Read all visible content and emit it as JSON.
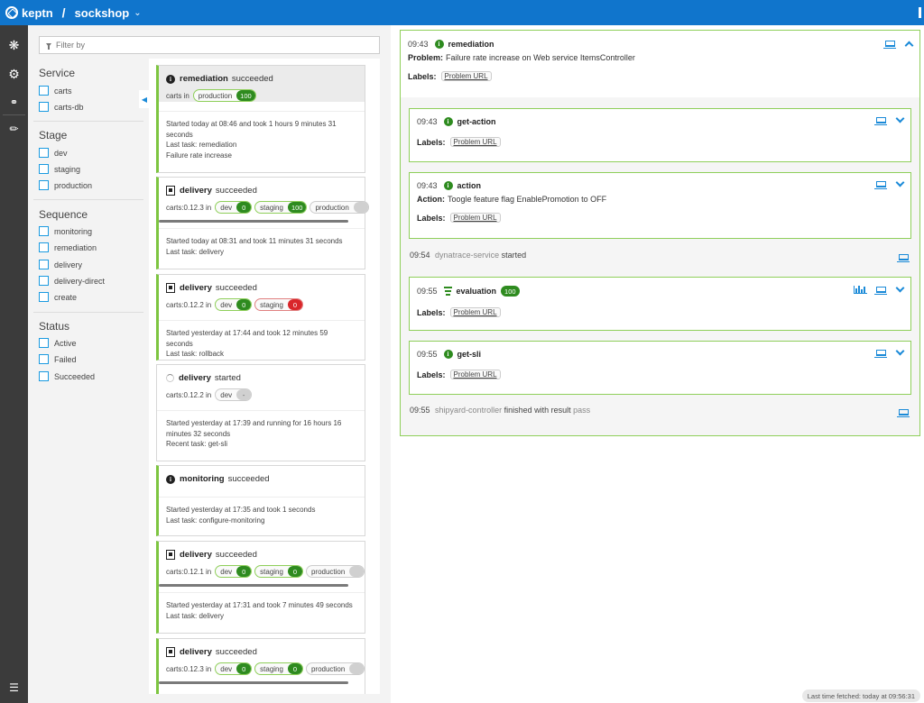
{
  "header": {
    "brand": "keptn",
    "separator": "/",
    "project": "sockshop",
    "project_chevron": "chevron-down-icon"
  },
  "nav": {
    "icons": [
      "services-icon",
      "settings-icon",
      "integrations-icon",
      "sequences-icon",
      "menu-icon"
    ]
  },
  "filter": {
    "placeholder": "Filter by",
    "groups": {
      "service": {
        "title": "Service",
        "options": [
          "carts",
          "carts-db"
        ]
      },
      "stage": {
        "title": "Stage",
        "options": [
          "dev",
          "staging",
          "production"
        ]
      },
      "sequence": {
        "title": "Sequence",
        "options": [
          "monitoring",
          "remediation",
          "delivery",
          "delivery-direct",
          "create"
        ]
      },
      "status": {
        "title": "Status",
        "options": [
          "Active",
          "Failed",
          "Succeeded"
        ]
      }
    }
  },
  "sequences": [
    {
      "name": "remediation",
      "status": "succeeded",
      "lead": "carts in",
      "stages": [
        {
          "name": "production",
          "badge": "100"
        }
      ],
      "desc": [
        "Started today at 08:46 and took 1 hours 9 minutes 31",
        "seconds",
        "Last task: remediation",
        "Failure rate increase"
      ]
    },
    {
      "name": "delivery",
      "status": "succeeded",
      "lead": "carts:0.12.3 in",
      "stages": [
        {
          "name": "dev",
          "badge": "0"
        },
        {
          "name": "staging",
          "badge": "100"
        },
        {
          "name": "production",
          "badge": ""
        }
      ],
      "desc": [
        "Started today at 08:31 and took 11 minutes 31 seconds",
        "Last task: delivery"
      ]
    },
    {
      "name": "delivery",
      "status": "succeeded",
      "lead": "carts:0.12.2 in",
      "stages": [
        {
          "name": "dev",
          "badge": "0"
        },
        {
          "name": "staging",
          "badge": "0"
        }
      ],
      "desc": [
        "Started yesterday at 17:44 and took 12 minutes 59 seconds",
        "Last task: rollback"
      ]
    },
    {
      "name": "delivery",
      "status": "started",
      "lead": "carts:0.12.2 in",
      "stages": [
        {
          "name": "dev",
          "badge": "-"
        }
      ],
      "desc": [
        "Started yesterday at 17:39 and running for 16 hours 16",
        "minutes 32 seconds",
        "Recent task: get-sli"
      ]
    },
    {
      "name": "monitoring",
      "status": "succeeded",
      "desc": [
        "Started yesterday at 17:35 and took 1 seconds",
        "Last task: configure-monitoring"
      ]
    },
    {
      "name": "delivery",
      "status": "succeeded",
      "lead": "carts:0.12.1 in",
      "stages": [
        {
          "name": "dev",
          "badge": "0"
        },
        {
          "name": "staging",
          "badge": "0"
        },
        {
          "name": "production",
          "badge": ""
        }
      ],
      "desc": [
        "Started yesterday at 17:31 and took 7 minutes 49 seconds",
        "Last task: delivery"
      ]
    },
    {
      "name": "delivery",
      "status": "succeeded",
      "lead": "carts:0.12.3 in",
      "stages": [
        {
          "name": "dev",
          "badge": "0"
        },
        {
          "name": "staging",
          "badge": "0"
        },
        {
          "name": "production",
          "badge": ""
        }
      ]
    }
  ],
  "detail": {
    "time": "09:43",
    "name": "remediation",
    "problem_label": "Problem:",
    "problem_text": "Failure rate increase on Web service ItemsController",
    "labels_label": "Labels:",
    "label_tag": "Problem URL",
    "tasks": [
      {
        "time": "09:43",
        "name": "get-action",
        "labels_label": "Labels:",
        "label_tag": "Problem URL"
      },
      {
        "time": "09:43",
        "name": "action",
        "action_label": "Action:",
        "action_text": "Toogle feature flag EnablePromotion to OFF",
        "labels_label": "Labels:",
        "label_tag": "Problem URL"
      },
      {
        "time": "09:55",
        "name": "evaluation",
        "badge": "100",
        "labels_label": "Labels:",
        "label_tag": "Problem URL"
      },
      {
        "time": "09:55",
        "name": "get-sli",
        "labels_label": "Labels:",
        "label_tag": "Problem URL"
      }
    ],
    "events": [
      {
        "time": "09:54",
        "service": "dynatrace-service",
        "text": "started"
      },
      {
        "time": "09:55",
        "service": "shipyard-controller",
        "text": "finished with result",
        "result": "pass"
      }
    ]
  },
  "footer": {
    "last_fetched": "Last time fetched: today at 09:56:31"
  },
  "colors": {
    "header": "#1075cc",
    "success": "#2e8b1f",
    "failed": "#d9262a",
    "accent": "#1a8ad8",
    "border_green": "#8fcf5a"
  }
}
